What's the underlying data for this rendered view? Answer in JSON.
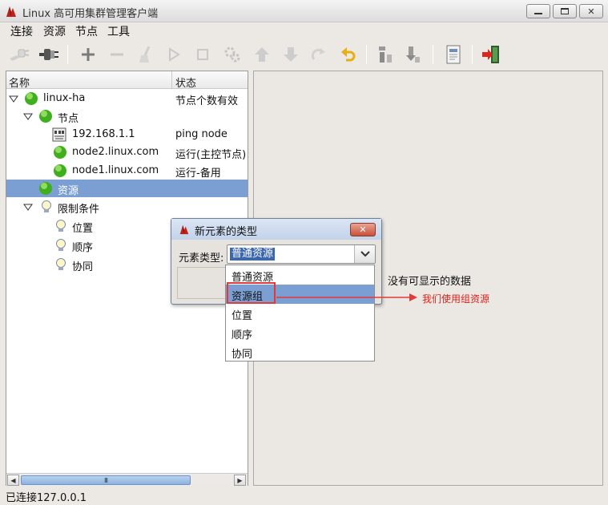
{
  "window": {
    "title": "Linux 高可用集群管理客户端",
    "min_label": "▭",
    "max_label": "▣",
    "close_label": "✕"
  },
  "menu": {
    "items": [
      "连接",
      "资源",
      "节点",
      "工具"
    ]
  },
  "toolbar": {
    "icons": [
      "disconnect-icon",
      "connect-icon",
      "add-icon",
      "remove-icon",
      "cleanup-icon",
      "start-icon",
      "stop-icon",
      "settings-icon",
      "move-up-icon",
      "move-down-icon",
      "redo-icon",
      "undo-icon",
      "standby-node-icon",
      "activate-node-icon",
      "log-icon",
      "exit-icon"
    ]
  },
  "tree": {
    "columns": {
      "name": "名称",
      "status": "状态"
    },
    "rows": [
      {
        "label": "linux-ha",
        "status": "节点个数有效",
        "icon": "green-status-icon",
        "expanded": true
      },
      {
        "label": "节点",
        "status": "",
        "icon": "green-status-icon",
        "expanded": true
      },
      {
        "label": "192.168.1.1",
        "status": "ping node",
        "icon": "network-icon"
      },
      {
        "label": "node2.linux.com",
        "status": "运行(主控节点)",
        "icon": "green-status-icon"
      },
      {
        "label": "node1.linux.com",
        "status": "运行-备用",
        "icon": "green-status-icon"
      },
      {
        "label": "资源",
        "status": "",
        "icon": "green-status-icon",
        "selected": true
      },
      {
        "label": "限制条件",
        "status": "",
        "icon": "lightbulb-icon",
        "expanded": true
      },
      {
        "label": "位置",
        "status": "",
        "icon": "lightbulb-icon"
      },
      {
        "label": "顺序",
        "status": "",
        "icon": "lightbulb-icon"
      },
      {
        "label": "协同",
        "status": "",
        "icon": "lightbulb-icon"
      }
    ],
    "scroll_thumb": "III"
  },
  "detail": {
    "empty_message": "没有可显示的数据"
  },
  "status_bar": {
    "text": "已连接127.0.0.1"
  },
  "dialog": {
    "title": "新元素的类型",
    "field_label": "元素类型:",
    "selected_value": "普通资源",
    "close_label": "✕",
    "options": [
      "普通资源",
      "资源组",
      "位置",
      "顺序",
      "协同"
    ],
    "highlighted_option": "资源组"
  },
  "annotation": {
    "text": "我们使用组资源",
    "color": "#e0201a"
  },
  "colors": {
    "selection": "#7b9fd2",
    "status_green": "#3fae1f",
    "dialog_title": "#c2d3ea"
  }
}
